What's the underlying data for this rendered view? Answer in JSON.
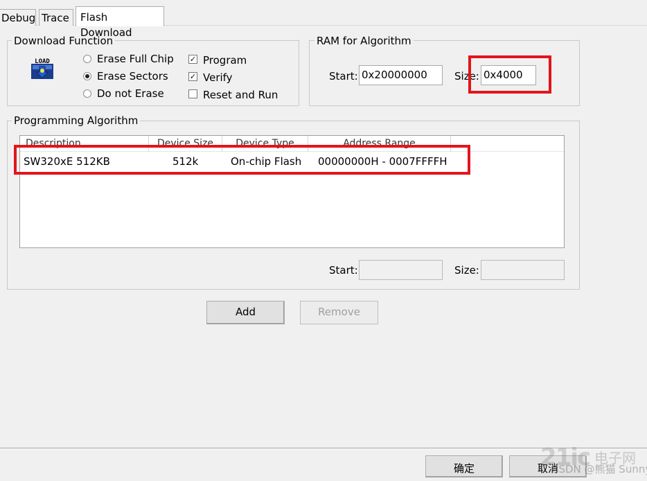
{
  "tabs": [
    {
      "label": "Debug"
    },
    {
      "label": "Trace"
    },
    {
      "label": "Flash Download",
      "active": true
    }
  ],
  "download_function": {
    "title": "Download Function",
    "icon_text": "LOAD",
    "radios": [
      {
        "label": "Erase Full Chip",
        "selected": false
      },
      {
        "label": "Erase Sectors",
        "selected": true
      },
      {
        "label": "Do not Erase",
        "selected": false
      }
    ],
    "checkboxes": [
      {
        "label": "Program",
        "checked": true
      },
      {
        "label": "Verify",
        "checked": true
      },
      {
        "label": "Reset and Run",
        "checked": false
      }
    ]
  },
  "ram_for_algorithm": {
    "title": "RAM for Algorithm",
    "start_label": "Start:",
    "start_value": "0x20000000",
    "size_label": "Size:",
    "size_value": "0x4000"
  },
  "programming_algorithm": {
    "title": "Programming Algorithm",
    "columns": [
      "Description",
      "Device Size",
      "Device Type",
      "Address Range"
    ],
    "rows": [
      {
        "description": "SW320xE 512KB",
        "device_size": "512k",
        "device_type": "On-chip Flash",
        "address_range": "00000000H - 0007FFFFH"
      }
    ],
    "start_label": "Start:",
    "start_value": "",
    "size_label": "Size:",
    "size_value": ""
  },
  "buttons": {
    "add": "Add",
    "remove": "Remove",
    "ok": "确定",
    "cancel": "取消"
  },
  "watermark": {
    "text": "电子网",
    "text2": "CSDN @熊猫 Sunny"
  },
  "colors": {
    "highlight_red": "#e3141b",
    "window_bg": "#f0f0f0"
  }
}
